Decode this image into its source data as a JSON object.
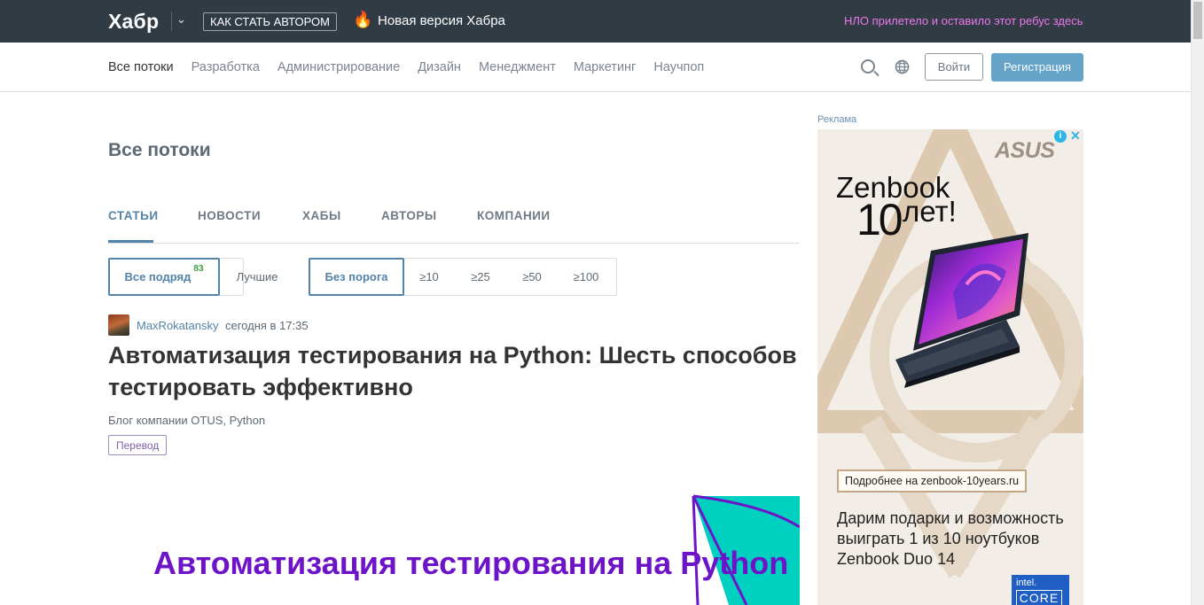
{
  "topbar": {
    "logo": "Хабр",
    "author_button": "КАК СТАТЬ АВТОРОМ",
    "new_version": "Новая версия Хабра",
    "ufo_text": "НЛО прилетело и оставило этот ребус здесь"
  },
  "nav": {
    "items": [
      "Все потоки",
      "Разработка",
      "Администрирование",
      "Дизайн",
      "Менеджмент",
      "Маркетинг",
      "Научпоп"
    ],
    "login": "Войти",
    "register": "Регистрация"
  },
  "page": {
    "title": "Все потоки",
    "tabs": [
      "СТАТЬИ",
      "НОВОСТИ",
      "ХАБЫ",
      "АВТОРЫ",
      "КОМПАНИИ"
    ],
    "filters": {
      "all": "Все подряд",
      "all_count": "83",
      "best": "Лучшие",
      "threshold": [
        "Без порога",
        "≥10",
        "≥25",
        "≥50",
        "≥100"
      ]
    }
  },
  "post": {
    "author": "MaxRokatansky",
    "time": "сегодня в 17:35",
    "title": "Автоматизация тестирования на Python: Шесть способов тестировать эффективно",
    "hubs": "Блог компании OTUS,  Python",
    "badge": "Перевод",
    "cover_text": "Автоматизация тестирования на Python"
  },
  "ad": {
    "label": "Реклама",
    "brand": "ASUS",
    "headline_1": "Zenbook",
    "headline_num": "10",
    "headline_2": "лет!",
    "more": "Подробнее на zenbook-10years.ru",
    "promo": "Дарим подарки и возможность выиграть 1 из 10 ноутбуков Zenbook Duo 14",
    "intel_1": "intel.",
    "intel_2": "CORE"
  },
  "colors": {
    "topbar": "#303b44",
    "accent": "#5383a8",
    "register": "#65a3c9",
    "ufo": "#ee77ee",
    "cover_purple": "#6d14c9",
    "cover_teal": "#00d0c0"
  }
}
